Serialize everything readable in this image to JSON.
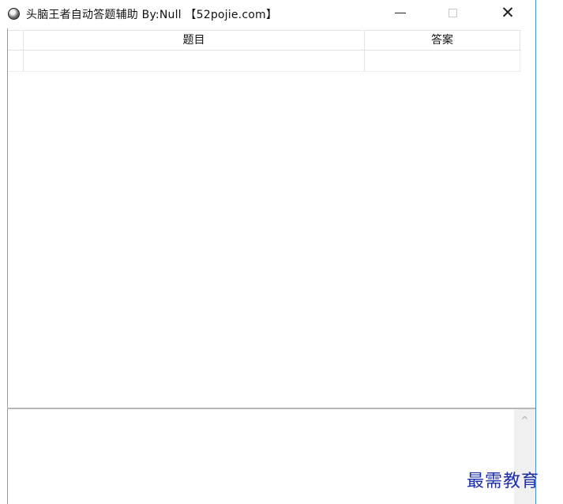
{
  "window": {
    "title": "头脑王者自动答题辅助  By:Null  【52pojie.com】",
    "minimize_glyph": "—",
    "maximize_glyph": "□",
    "close_glyph": "✕",
    "icon": "app-icon"
  },
  "table": {
    "columns": [
      "题目",
      "答案"
    ],
    "rows": [
      {
        "question": "",
        "answer": ""
      }
    ]
  },
  "log": {
    "value": "",
    "scroll_up_glyph": "^"
  },
  "watermark": {
    "text": "最需教育"
  },
  "colors": {
    "window_border": "#4a90d9",
    "watermark": "#1d2fa8",
    "grid_line": "#e3e3e3"
  }
}
